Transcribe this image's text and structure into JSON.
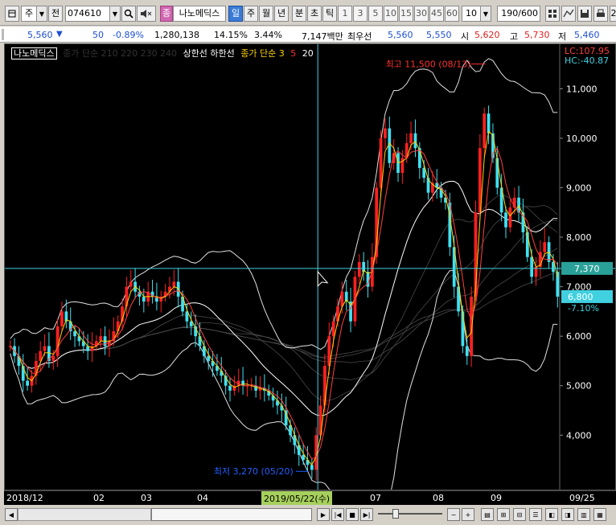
{
  "toolbar": {
    "market_select": "주",
    "search_label": "전",
    "stock_code": "074610",
    "stock_name": "나노메딕스",
    "stock_name_badge": "종",
    "periods": [
      "일",
      "주",
      "월",
      "년",
      "분",
      "초",
      "틱"
    ],
    "active_period": "일",
    "intervals": [
      "1",
      "3",
      "5",
      "10",
      "15",
      "30",
      "45",
      "60"
    ],
    "interval_value": "10",
    "count_value": "190",
    "count_total": "/600",
    "right_cut": "2"
  },
  "quote": {
    "price": "5,560",
    "change_arrow": "▼",
    "change": "50",
    "change_pct": "-0.89%",
    "volume": "1,280,138",
    "turnover_pct": "14.15%",
    "ratio_pct": "3.44%",
    "amount": "7,147백만",
    "best_ask_label": "최우선",
    "best_ask": "5,560",
    "best_bid": "5,550",
    "open_label": "시",
    "open": "5,620",
    "high_label": "고",
    "high": "5,730",
    "low_label": "저",
    "low": "5,460"
  },
  "legend": {
    "name": "나노메딕스",
    "ma_label": "종가 단순 210  220  230  240",
    "band_label": "상한선  하한선",
    "ma2_label": "종가 단순 3",
    "ma2_a": "5",
    "ma2_b": "20"
  },
  "chart_data": {
    "type": "candlestick",
    "yticks": [
      4000,
      5000,
      6000,
      7000,
      8000,
      9000,
      10000,
      11000
    ],
    "ylim": [
      2900,
      11900
    ],
    "x_labels": [
      "2018/12",
      "02",
      "03",
      "04",
      "05",
      "07",
      "08",
      "09",
      "09/25"
    ],
    "highlight_date": "2019/05/22(수)",
    "max_label": "최고 11,500 (08/13)",
    "min_label": "최저 3,270 (05/20)",
    "lc_label": "LC:107.95",
    "hc_label": "HC:-40.87",
    "crosshair_price": "7,370",
    "last_price": "6,800",
    "last_change": "-7.10%",
    "closes": [
      5800,
      5600,
      5400,
      5100,
      5000,
      5200,
      5500,
      5700,
      5800,
      5500,
      5600,
      6200,
      6500,
      6300,
      6100,
      6000,
      5900,
      5800,
      5700,
      5800,
      5900,
      6000,
      5800,
      5900,
      6100,
      6300,
      6600,
      7000,
      7100,
      6900,
      6800,
      6700,
      6900,
      6800,
      6700,
      6800,
      6900,
      7000,
      7100,
      6800,
      6500,
      6300,
      6200,
      6000,
      5800,
      5600,
      5500,
      5400,
      5300,
      5200,
      5000,
      4900,
      5000,
      5100,
      5000,
      5000,
      5000,
      4900,
      4950,
      4900,
      4800,
      4700,
      4600,
      4500,
      4200,
      4000,
      3800,
      3600,
      3500,
      3400,
      3300,
      4000,
      4600,
      5400,
      6000,
      6300,
      6600,
      6900,
      6700,
      6300,
      7200,
      7500,
      7300,
      7000,
      7600,
      9000,
      10000,
      10200,
      9500,
      9700,
      9300,
      9600,
      9900,
      10100,
      9800,
      9400,
      9200,
      8900,
      9100,
      9000,
      8800,
      8700,
      7800,
      7000,
      6500,
      5800,
      5600,
      6800,
      8500,
      9800,
      10500,
      10100,
      9600,
      9000,
      8500,
      8200,
      8600,
      8800,
      8500,
      8100,
      7600,
      7200,
      7400,
      7700,
      7900,
      7500,
      7300,
      6800
    ]
  }
}
